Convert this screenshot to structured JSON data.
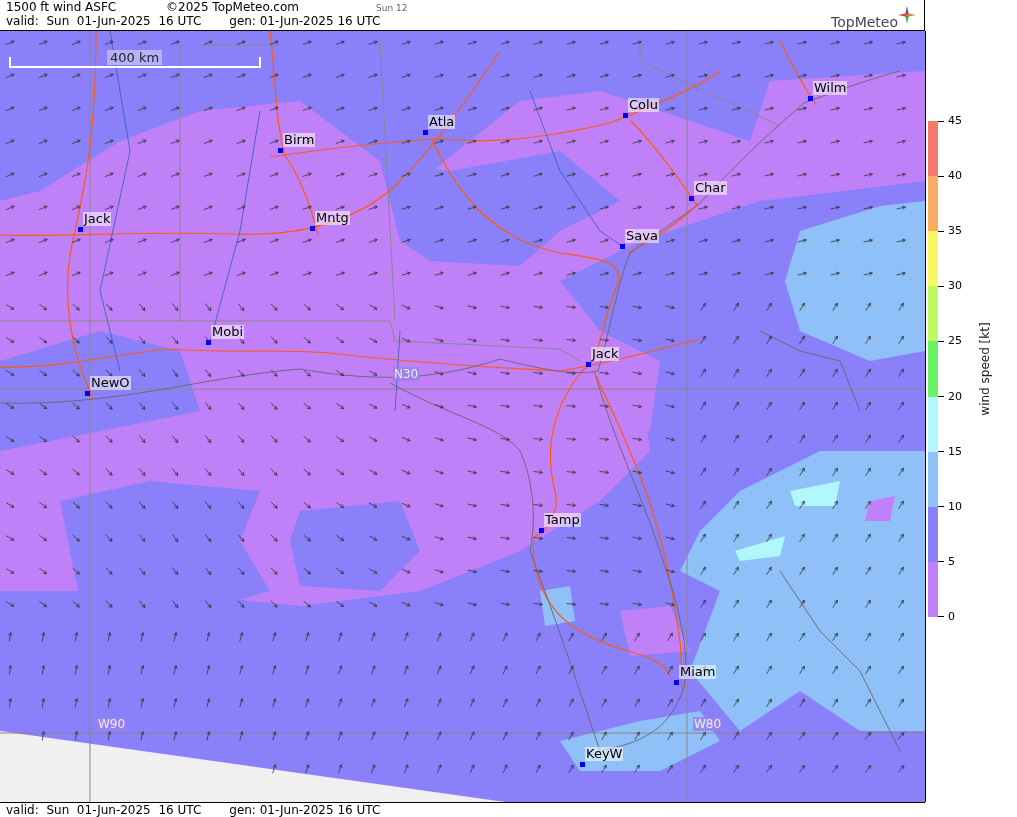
{
  "header": {
    "title": "1500 ft wind ASFC",
    "copyright": "©2025 TopMeteo.com",
    "run": "Sun 12",
    "valid": "valid:  Sun  01-Jun-2025  16 UTC",
    "generated": "gen: 01-Jun-2025 16 UTC",
    "logo": "TopMeteo"
  },
  "map": {
    "scale_label": "400 km",
    "grid_labels": [
      "N30",
      "W90",
      "W80"
    ],
    "cities": [
      {
        "name": "Birm"
      },
      {
        "name": "Atla"
      },
      {
        "name": "Colu"
      },
      {
        "name": "Wilm"
      },
      {
        "name": "Jack"
      },
      {
        "name": "Mntg"
      },
      {
        "name": "Char"
      },
      {
        "name": "Sava"
      },
      {
        "name": "Mobi"
      },
      {
        "name": "Jack"
      },
      {
        "name": "NewO"
      },
      {
        "name": "Tamp"
      },
      {
        "name": "Miam"
      },
      {
        "name": "KeyW"
      }
    ]
  },
  "legend": {
    "title": "wind speed [kt]",
    "ticks": [
      "45",
      "40",
      "35",
      "30",
      "25",
      "20",
      "15",
      "10",
      "5",
      "0"
    ],
    "bands": [
      {
        "color": "#f07c6c"
      },
      {
        "color": "#f8ac64"
      },
      {
        "color": "#f8f864"
      },
      {
        "color": "#c0f864"
      },
      {
        "color": "#6cf064"
      },
      {
        "color": "#b0f8fc"
      },
      {
        "color": "#90c0f8"
      },
      {
        "color": "#8a80fa"
      },
      {
        "color": "#c080f8"
      }
    ]
  },
  "footer": {
    "valid": "valid:  Sun  01-Jun-2025  16 UTC",
    "generated": "gen: 01-Jun-2025 16 UTC"
  }
}
